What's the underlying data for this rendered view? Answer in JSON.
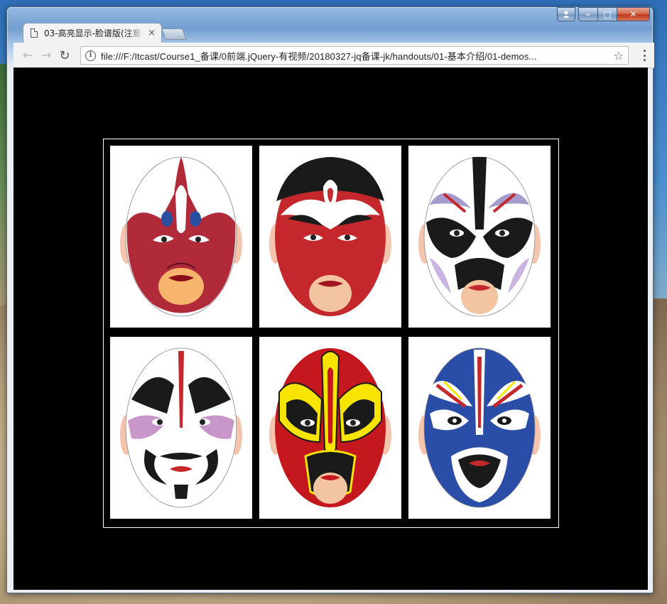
{
  "browser": {
    "tab_title": "03-高亮显示-脸谱版(注意",
    "tab_close": "×",
    "url": "file:///F:/Itcast/Course1_备课/0前端.jQuery-有视频/20180327-jq备课-jk/handouts/01-基本介绍/01-demos...",
    "controls": {
      "minimize": "–",
      "maximize": "□",
      "close": "✕"
    }
  },
  "gallery": {
    "masks": [
      {
        "name": "red-white-mask",
        "base": "#b12a3a",
        "accent": "#2b4fa0"
      },
      {
        "name": "red-black-crown-mask",
        "base": "#c4282c",
        "accent": "#1a1a1a"
      },
      {
        "name": "white-black-purple-mask",
        "base": "#ffffff",
        "accent": "#a79acc"
      },
      {
        "name": "white-black-pink-mask",
        "base": "#ffffff",
        "accent": "#b06ab0"
      },
      {
        "name": "red-yellow-mask",
        "base": "#c4181e",
        "accent": "#f7e400"
      },
      {
        "name": "blue-red-mask",
        "base": "#2a4ea8",
        "accent": "#c4282c"
      }
    ]
  }
}
